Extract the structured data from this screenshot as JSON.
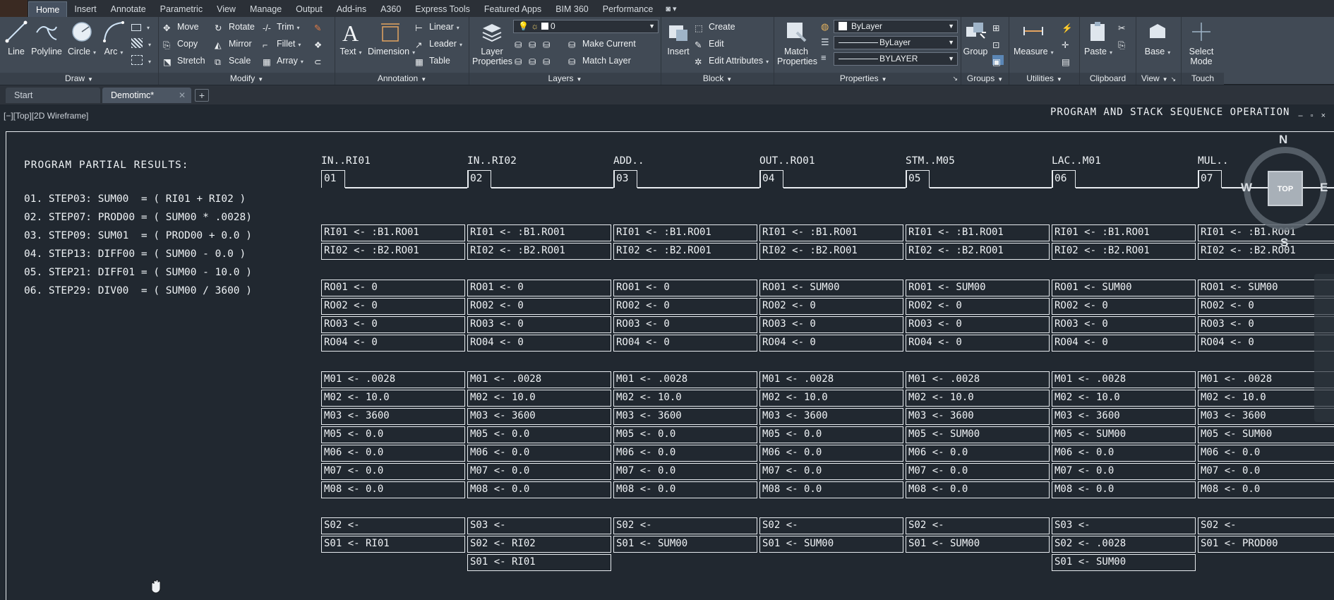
{
  "ribbon_tabs": [
    "Home",
    "Insert",
    "Annotate",
    "Parametric",
    "View",
    "Manage",
    "Output",
    "Add-ins",
    "A360",
    "Express Tools",
    "Featured Apps",
    "BIM 360",
    "Performance"
  ],
  "ribbon_tab_extra": "◙ ▾",
  "draw": {
    "title": "Draw",
    "line": "Line",
    "polyline": "Polyline",
    "circle": "Circle",
    "arc": "Arc"
  },
  "modify": {
    "title": "Modify",
    "move": "Move",
    "rotate": "Rotate",
    "trim": "Trim",
    "copy": "Copy",
    "mirror": "Mirror",
    "fillet": "Fillet",
    "stretch": "Stretch",
    "scale": "Scale",
    "array": "Array"
  },
  "annotation": {
    "title": "Annotation",
    "text": "Text",
    "dimension": "Dimension",
    "linear": "Linear",
    "leader": "Leader",
    "table": "Table"
  },
  "layers": {
    "title": "Layers",
    "layer_properties": "Layer Properties",
    "layer_value": "0",
    "make_current": "Make Current",
    "match_layer": "Match Layer"
  },
  "block": {
    "title": "Block",
    "insert": "Insert",
    "create": "Create",
    "edit": "Edit",
    "edit_attributes": "Edit Attributes"
  },
  "properties": {
    "title": "Properties",
    "match_properties": "Match Properties",
    "color": "ByLayer",
    "linetype": "ByLayer",
    "lineweight": "BYLAYER"
  },
  "groups": {
    "title": "Groups",
    "group": "Group"
  },
  "utilities": {
    "title": "Utilities",
    "measure": "Measure"
  },
  "clipboard": {
    "title": "Clipboard",
    "paste": "Paste"
  },
  "view_panel": {
    "title": "View",
    "base": "Base"
  },
  "touch": {
    "title": "Touch",
    "select_mode": "Select Mode"
  },
  "doc_tabs": [
    {
      "label": "Start",
      "active": false
    },
    {
      "label": "Demotimc*",
      "active": true
    }
  ],
  "add_tab": "+",
  "viewport": {
    "label": "[−][Top][2D Wireframe]",
    "title": "PROGRAM AND STACK SEQUENCE OPERATION",
    "controls": "– ▫ ×"
  },
  "results": {
    "title": "PROGRAM PARTIAL RESULTS:",
    "lines": [
      "01. STEP03: SUM00  = ( RI01 + RI02 )",
      "02. STEP07: PROD00 = ( SUM00 * .0028)",
      "03. STEP09: SUM01  = ( PROD00 + 0.0 )",
      "04. STEP13: DIFF00 = ( SUM00 - 0.0 )",
      "05. STEP21: DIFF01 = ( SUM00 - 10.0 )",
      "06. STEP29: DIV00  = ( SUM00 / 3600 )"
    ]
  },
  "steps": [
    {
      "op": "IN..RI01",
      "num": "01",
      "inputs": [
        "RI01 <- :B1.RO01",
        "RI02 <- :B2.RO01"
      ],
      "ro": [
        "RO01 <- 0",
        "RO02 <- 0",
        "RO03 <- 0",
        "RO04 <- 0"
      ],
      "mem": [
        "M01 <- .0028",
        "M02 <- 10.0",
        "M03 <- 3600",
        "M05 <- 0.0",
        "M06 <- 0.0",
        "M07 <- 0.0",
        "M08 <- 0.0"
      ],
      "stack": [
        "S02 <-",
        "S01 <- RI01"
      ]
    },
    {
      "op": "IN..RI02",
      "num": "02",
      "inputs": [
        "RI01 <- :B1.RO01",
        "RI02 <- :B2.RO01"
      ],
      "ro": [
        "RO01 <- 0",
        "RO02 <- 0",
        "RO03 <- 0",
        "RO04 <- 0"
      ],
      "mem": [
        "M01 <- .0028",
        "M02 <- 10.0",
        "M03 <- 3600",
        "M05 <- 0.0",
        "M06 <- 0.0",
        "M07 <- 0.0",
        "M08 <- 0.0"
      ],
      "stack": [
        "S03 <-",
        "S02 <- RI02",
        "S01 <- RI01"
      ]
    },
    {
      "op": "ADD..",
      "num": "03",
      "inputs": [
        "RI01 <- :B1.RO01",
        "RI02 <- :B2.RO01"
      ],
      "ro": [
        "RO01 <- 0",
        "RO02 <- 0",
        "RO03 <- 0",
        "RO04 <- 0"
      ],
      "mem": [
        "M01 <- .0028",
        "M02 <- 10.0",
        "M03 <- 3600",
        "M05 <- 0.0",
        "M06 <- 0.0",
        "M07 <- 0.0",
        "M08 <- 0.0"
      ],
      "stack": [
        "S02 <-",
        "S01 <- SUM00"
      ]
    },
    {
      "op": "OUT..RO01",
      "num": "04",
      "inputs": [
        "RI01 <- :B1.RO01",
        "RI02 <- :B2.RO01"
      ],
      "ro": [
        "RO01 <- SUM00",
        "RO02 <- 0",
        "RO03 <- 0",
        "RO04 <- 0"
      ],
      "mem": [
        "M01 <- .0028",
        "M02 <- 10.0",
        "M03 <- 3600",
        "M05 <- 0.0",
        "M06 <- 0.0",
        "M07 <- 0.0",
        "M08 <- 0.0"
      ],
      "stack": [
        "S02 <-",
        "S01 <- SUM00"
      ]
    },
    {
      "op": "STM..M05",
      "num": "05",
      "inputs": [
        "RI01 <- :B1.RO01",
        "RI02 <- :B2.RO01"
      ],
      "ro": [
        "RO01 <- SUM00",
        "RO02 <- 0",
        "RO03 <- 0",
        "RO04 <- 0"
      ],
      "mem": [
        "M01 <- .0028",
        "M02 <- 10.0",
        "M03 <- 3600",
        "M05 <- SUM00",
        "M06 <- 0.0",
        "M07 <- 0.0",
        "M08 <- 0.0"
      ],
      "stack": [
        "S02 <-",
        "S01 <- SUM00"
      ]
    },
    {
      "op": "LAC..M01",
      "num": "06",
      "inputs": [
        "RI01 <- :B1.RO01",
        "RI02 <- :B2.RO01"
      ],
      "ro": [
        "RO01 <- SUM00",
        "RO02 <- 0",
        "RO03 <- 0",
        "RO04 <- 0"
      ],
      "mem": [
        "M01 <- .0028",
        "M02 <- 10.0",
        "M03 <- 3600",
        "M05 <- SUM00",
        "M06 <- 0.0",
        "M07 <- 0.0",
        "M08 <- 0.0"
      ],
      "stack": [
        "S03 <-",
        "S02 <- .0028",
        "S01 <- SUM00"
      ]
    },
    {
      "op": "MUL..",
      "num": "07",
      "inputs": [
        "RI01 <- :B1.RO01",
        "RI02 <- :B2.RO01"
      ],
      "ro": [
        "RO01 <- SUM00",
        "RO02 <- 0",
        "RO03 <- 0",
        "RO04 <- 0"
      ],
      "mem": [
        "M01 <- .0028",
        "M02 <- 10.0",
        "M03 <- 3600",
        "M05 <- SUM00",
        "M06 <- 0.0",
        "M07 <- 0.0",
        "M08 <- 0.0"
      ],
      "stack": [
        "S02 <-",
        "S01 <- PROD00"
      ]
    }
  ],
  "viewcube": {
    "n": "N",
    "s": "S",
    "e": "E",
    "w": "W",
    "top": "TOP"
  }
}
